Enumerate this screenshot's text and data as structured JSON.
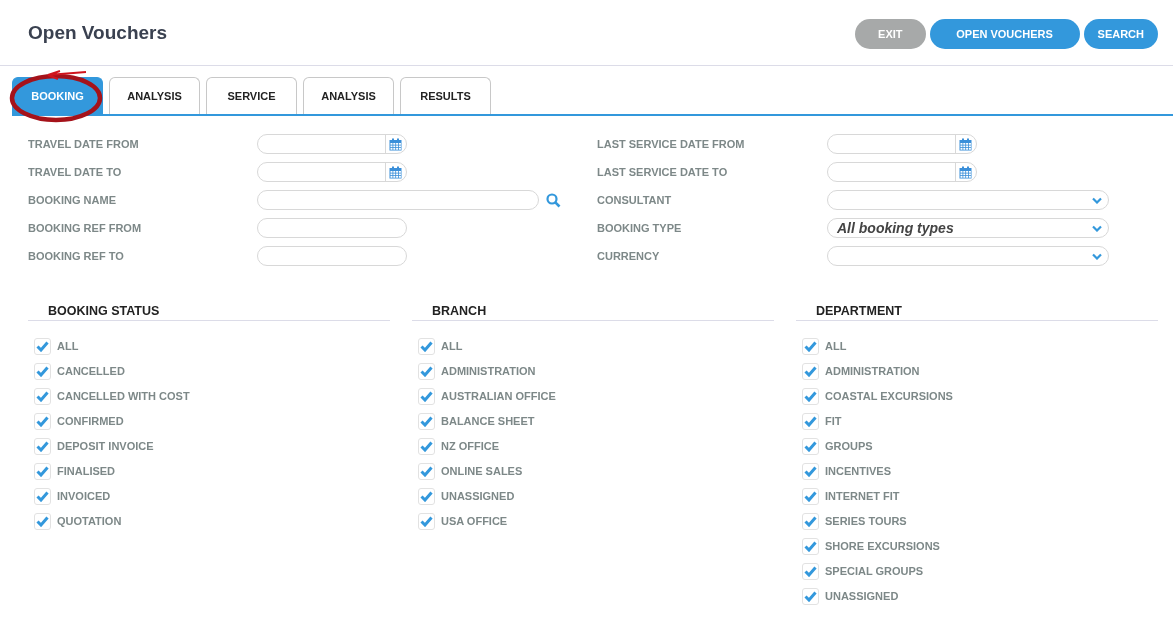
{
  "title": "Open Vouchers",
  "actions": [
    {
      "label": "EXIT",
      "kind": "secondary"
    },
    {
      "label": "OPEN VOUCHERS",
      "kind": "primary"
    },
    {
      "label": "SEARCH",
      "kind": "primary"
    }
  ],
  "tabs": [
    {
      "label": "BOOKING",
      "selected": true,
      "annotated": true
    },
    {
      "label": "ANALYSIS",
      "selected": false,
      "annotated": false
    },
    {
      "label": "SERVICE",
      "selected": false,
      "annotated": false
    },
    {
      "label": "ANALYSIS",
      "selected": false,
      "annotated": false
    },
    {
      "label": "RESULTS",
      "selected": false,
      "annotated": false
    }
  ],
  "form_left": [
    {
      "label": "TRAVEL DATE FROM",
      "kind": "date"
    },
    {
      "label": "TRAVEL DATE TO",
      "kind": "date"
    },
    {
      "label": "BOOKING NAME",
      "kind": "search"
    },
    {
      "label": "BOOKING REF FROM",
      "kind": "text"
    },
    {
      "label": "BOOKING REF TO",
      "kind": "text"
    }
  ],
  "form_right": [
    {
      "label": "LAST SERVICE DATE FROM",
      "kind": "date"
    },
    {
      "label": "LAST SERVICE DATE TO",
      "kind": "date"
    },
    {
      "label": "CONSULTANT",
      "kind": "select"
    },
    {
      "label": "BOOKING TYPE",
      "kind": "select",
      "value": "All booking types"
    },
    {
      "label": "CURRENCY",
      "kind": "select"
    }
  ],
  "groups": [
    {
      "title": "BOOKING STATUS",
      "items": [
        {
          "label": "ALL",
          "checked": true
        },
        {
          "label": "CANCELLED",
          "checked": true
        },
        {
          "label": "CANCELLED WITH COST",
          "checked": true
        },
        {
          "label": "CONFIRMED",
          "checked": true
        },
        {
          "label": "DEPOSIT INVOICE",
          "checked": true
        },
        {
          "label": "FINALISED",
          "checked": true
        },
        {
          "label": "INVOICED",
          "checked": true
        },
        {
          "label": "QUOTATION",
          "checked": true
        }
      ]
    },
    {
      "title": "BRANCH",
      "items": [
        {
          "label": "ALL",
          "checked": true
        },
        {
          "label": "ADMINISTRATION",
          "checked": true
        },
        {
          "label": "AUSTRALIAN OFFICE",
          "checked": true
        },
        {
          "label": "BALANCE SHEET",
          "checked": true
        },
        {
          "label": "NZ OFFICE",
          "checked": true
        },
        {
          "label": "ONLINE SALES",
          "checked": true
        },
        {
          "label": "UNASSIGNED",
          "checked": true
        },
        {
          "label": "USA OFFICE",
          "checked": true
        }
      ]
    },
    {
      "title": "DEPARTMENT",
      "items": [
        {
          "label": "ALL",
          "checked": true
        },
        {
          "label": "ADMINISTRATION",
          "checked": true
        },
        {
          "label": "COASTAL EXCURSIONS",
          "checked": true
        },
        {
          "label": "FIT",
          "checked": true
        },
        {
          "label": "GROUPS",
          "checked": true
        },
        {
          "label": "INCENTIVES",
          "checked": true
        },
        {
          "label": "INTERNET FIT",
          "checked": true
        },
        {
          "label": "SERIES TOURS",
          "checked": true
        },
        {
          "label": "SHORE EXCURSIONS",
          "checked": true
        },
        {
          "label": "SPECIAL GROUPS",
          "checked": true
        },
        {
          "label": "UNASSIGNED",
          "checked": true
        }
      ]
    }
  ]
}
